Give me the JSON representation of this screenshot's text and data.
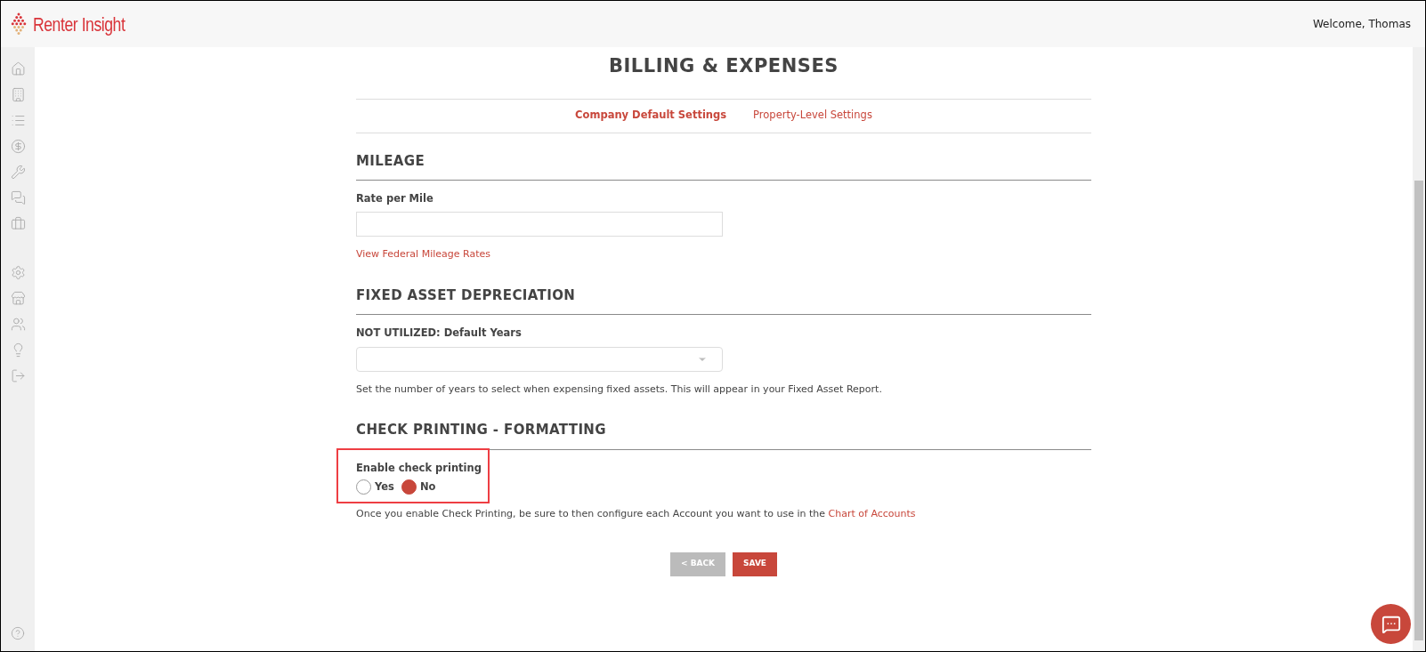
{
  "header": {
    "brand": "Renter Insight",
    "welcome": "Welcome, Thomas"
  },
  "page": {
    "title": "BILLING & EXPENSES",
    "tabs": [
      {
        "label": "Company Default Settings",
        "selected": true
      },
      {
        "label": "Property-Level Settings",
        "selected": false
      }
    ],
    "mileage": {
      "heading": "MILEAGE",
      "label": "Rate per Mile",
      "link": "View Federal Mileage Rates"
    },
    "depreciation": {
      "heading": "FIXED ASSET DEPRECIATION",
      "label": "NOT UTILIZED: Default Years",
      "note": "Set the number of years to select when expensing fixed assets. This will appear in your Fixed Asset Report."
    },
    "check_printing": {
      "heading": "CHECK PRINTING - FORMATTING",
      "label": "Enable check printing",
      "highlighted": true,
      "options": [
        {
          "label": "Yes",
          "selected": false
        },
        {
          "label": "No",
          "selected": true
        }
      ],
      "note": "Once you enable Check Printing, be sure to then configure each Account you want to use in the",
      "note_link": "Chart of Accounts"
    },
    "buttons": [
      {
        "label": "< BACK",
        "kind": "secondary"
      },
      {
        "label": "SAVE",
        "kind": "primary"
      }
    ]
  }
}
